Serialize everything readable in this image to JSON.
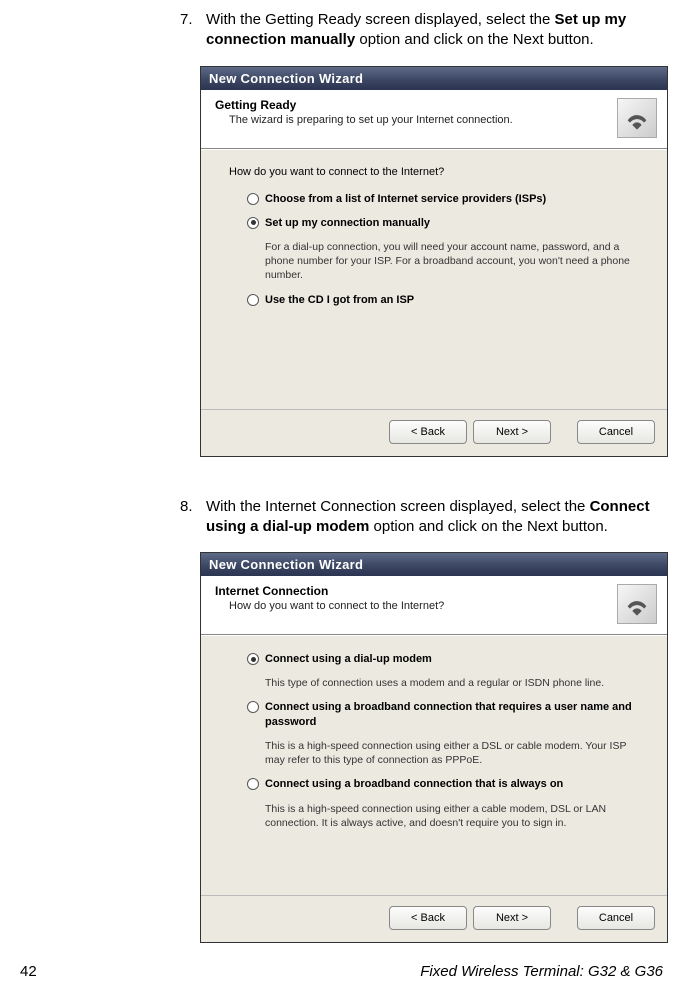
{
  "steps": [
    {
      "num": "7.",
      "text_pre": "With the Getting Ready screen displayed, select the ",
      "bold": "Set up my connection manually",
      "text_post": " option and click on the Next button."
    },
    {
      "num": "8.",
      "text_pre": "With the Internet Connection screen displayed, select the ",
      "bold": "Connect using a dial-up modem",
      "text_post": " option and click on the Next button."
    }
  ],
  "wizard1": {
    "title": "New Connection Wizard",
    "header_title": "Getting Ready",
    "header_sub": "The wizard is preparing to set up your Internet connection.",
    "question": "How do you want to connect to the Internet?",
    "options": [
      {
        "label": "Choose from a list of Internet service providers (ISPs)",
        "selected": false,
        "desc": ""
      },
      {
        "label": "Set up my connection manually",
        "selected": true,
        "desc": "For a dial-up connection, you will need your account name, password, and a phone number for your ISP. For a broadband account, you won't need a phone number."
      },
      {
        "label": "Use the CD I got from an ISP",
        "selected": false,
        "desc": ""
      }
    ],
    "buttons": {
      "back": "< Back",
      "next": "Next >",
      "cancel": "Cancel"
    }
  },
  "wizard2": {
    "title": "New Connection Wizard",
    "header_title": "Internet Connection",
    "header_sub": "How do you want to connect to the Internet?",
    "options": [
      {
        "label": "Connect using a dial-up modem",
        "selected": true,
        "desc": "This type of connection uses a modem and a regular or ISDN phone line."
      },
      {
        "label": "Connect using a broadband connection that requires a user name and password",
        "selected": false,
        "desc": "This is a high-speed connection using either a DSL or cable modem. Your ISP may refer to this type of connection as PPPoE."
      },
      {
        "label": "Connect using a broadband connection that is always on",
        "selected": false,
        "desc": "This is a high-speed connection using either a cable modem, DSL or LAN connection. It is always active, and doesn't require you to sign in."
      }
    ],
    "buttons": {
      "back": "< Back",
      "next": "Next >",
      "cancel": "Cancel"
    }
  },
  "footer": {
    "page": "42",
    "manual": "Fixed Wireless Terminal: G32 & G36"
  }
}
